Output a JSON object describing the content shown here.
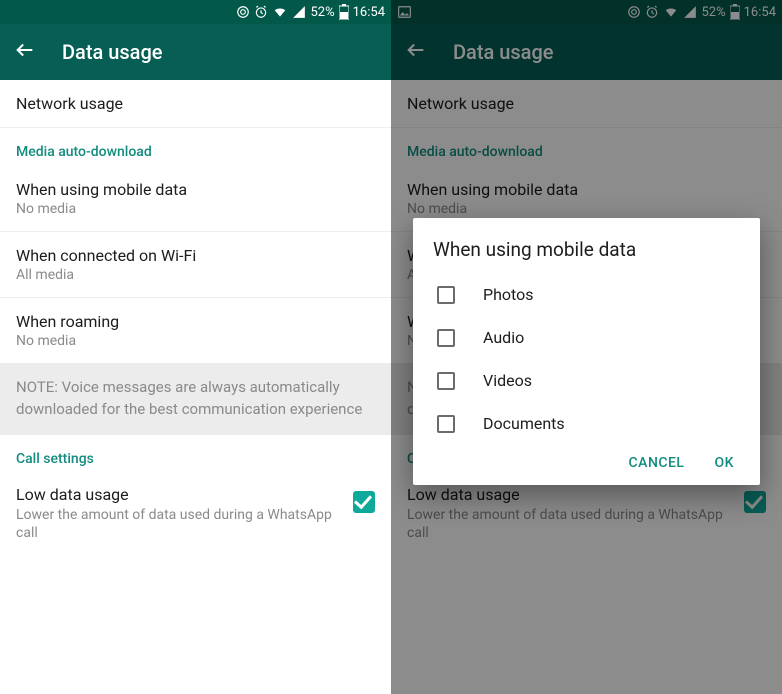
{
  "status": {
    "battery_pct": "52%",
    "time": "16:54"
  },
  "appbar": {
    "title": "Data usage"
  },
  "rows": {
    "network_usage": "Network usage",
    "media_header": "Media auto-download",
    "mobile": {
      "title": "When using mobile data",
      "sub": "No media"
    },
    "wifi": {
      "title": "When connected on Wi-Fi",
      "sub": "All media"
    },
    "roaming": {
      "title": "When roaming",
      "sub": "No media"
    },
    "note": "NOTE: Voice messages are always automatically downloaded for the best communication experience",
    "call_header": "Call settings",
    "low_data": {
      "title": "Low data usage",
      "sub": "Lower the amount of data used during a WhatsApp call"
    }
  },
  "dialog": {
    "title": "When using mobile data",
    "options": [
      "Photos",
      "Audio",
      "Videos",
      "Documents"
    ],
    "cancel": "CANCEL",
    "ok": "OK"
  }
}
